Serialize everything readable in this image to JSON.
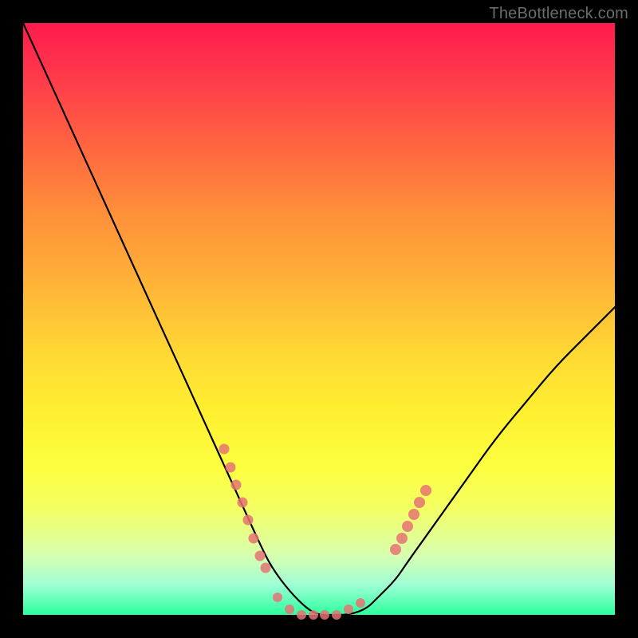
{
  "watermark": "TheBottleneck.com",
  "colors": {
    "gradient_top": "#ff1a4d",
    "gradient_bottom": "#2cff9d",
    "curve": "#000000",
    "dots": "#e57373",
    "frame": "#000000"
  },
  "chart_data": {
    "type": "line",
    "title": "",
    "xlabel": "",
    "ylabel": "",
    "xlim": [
      0,
      100
    ],
    "ylim": [
      0,
      100
    ],
    "x": [
      0,
      5,
      10,
      15,
      20,
      25,
      30,
      35,
      40,
      42,
      45,
      48,
      50,
      52,
      55,
      58,
      60,
      63,
      65,
      70,
      75,
      80,
      85,
      90,
      95,
      100
    ],
    "values": [
      100,
      89,
      78,
      67,
      56,
      45,
      34,
      23,
      12,
      8,
      4,
      1,
      0,
      0,
      0,
      1,
      3,
      6,
      9,
      16,
      23,
      30,
      36,
      42,
      47,
      52
    ],
    "dot_clusters": {
      "left_branch_x": [
        34,
        35,
        36,
        37,
        38,
        39,
        40,
        41
      ],
      "left_branch_y": [
        28,
        25,
        22,
        19,
        16,
        13,
        10,
        8
      ],
      "valley_x": [
        43,
        45,
        47,
        49,
        51,
        53,
        55,
        57
      ],
      "valley_y": [
        3,
        1,
        0,
        0,
        0,
        0,
        1,
        2
      ],
      "right_branch_x": [
        63,
        64,
        65,
        66,
        67,
        68
      ],
      "right_branch_y": [
        11,
        13,
        15,
        17,
        19,
        21
      ]
    }
  }
}
